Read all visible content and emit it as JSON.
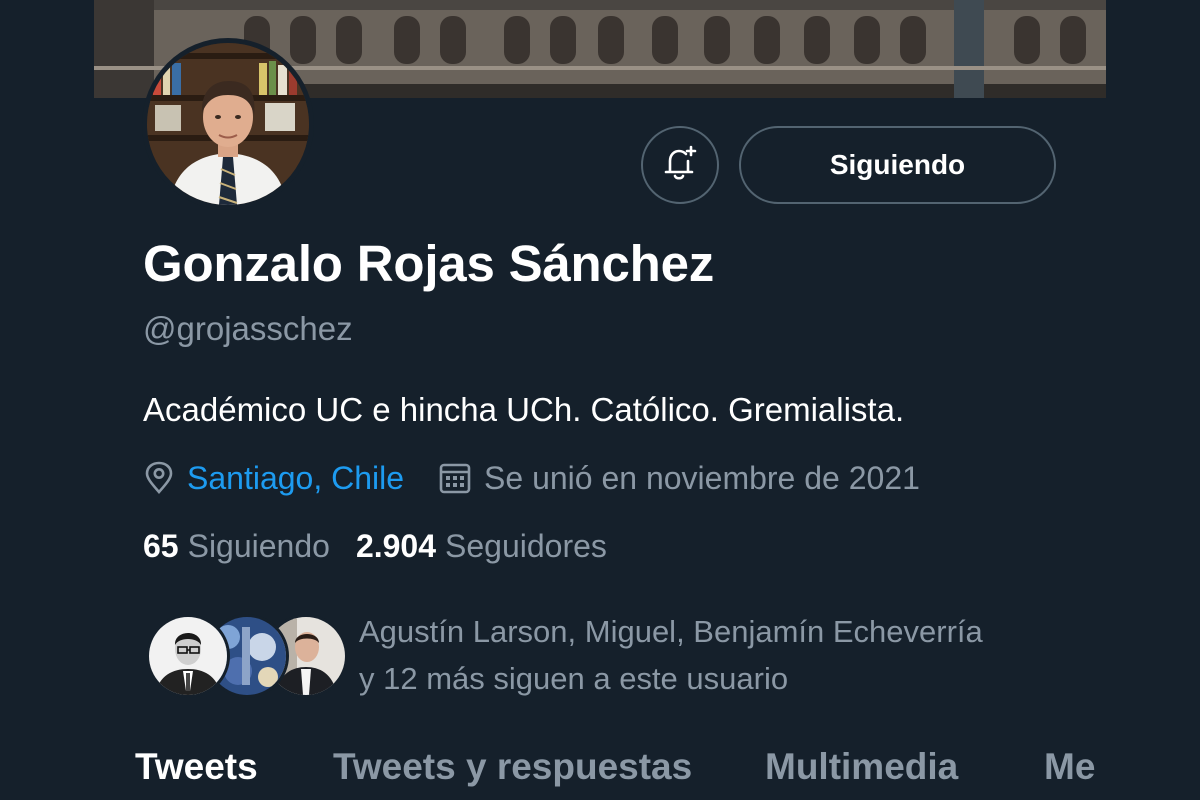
{
  "profile": {
    "display_name": "Gonzalo Rojas Sánchez",
    "handle": "@grojasschez",
    "bio": "Académico UC e hincha UCh. Católico. Gremialista.",
    "location": "Santiago, Chile",
    "joined": "Se unió en noviembre de 2021"
  },
  "actions": {
    "follow_label": "Siguiendo",
    "bell_icon": "bell-plus-icon"
  },
  "stats": {
    "following_count": "65",
    "following_label": "Siguiendo",
    "followers_count": "2.904",
    "followers_label": "Seguidores"
  },
  "followers_you_know": {
    "line1": "Agustín Larson, Miguel, Benjamín Echeverría",
    "line2": "y 12 más siguen a este usuario"
  },
  "tabs": [
    {
      "label": "Tweets",
      "active": true
    },
    {
      "label": "Tweets y respuestas",
      "active": false
    },
    {
      "label": "Multimedia",
      "active": false
    },
    {
      "label": "Me",
      "active": false
    }
  ],
  "icons": {
    "location": "map-pin-icon",
    "calendar": "calendar-icon"
  },
  "colors": {
    "background": "#15202b",
    "accent": "#1d9bf0",
    "secondary_text": "#8b98a5",
    "border": "#536471"
  }
}
